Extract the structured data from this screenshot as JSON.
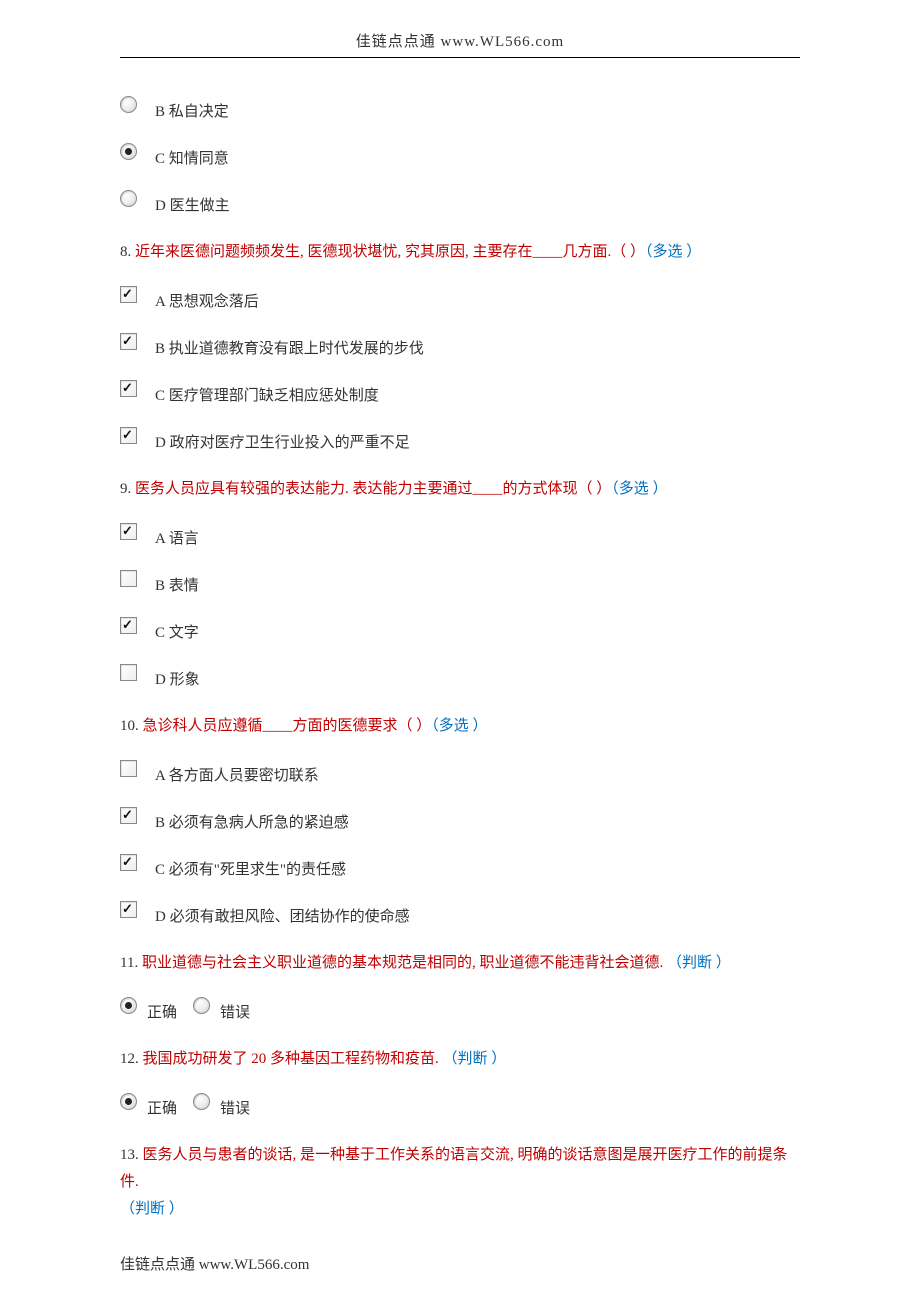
{
  "header": "佳链点点通 www.WL566.com",
  "footer": "佳链点点通 www.WL566.com",
  "q7_options": [
    {
      "key": "B",
      "text": "B 私自决定",
      "checked": false
    },
    {
      "key": "C",
      "text": "C 知情同意",
      "checked": true
    },
    {
      "key": "D",
      "text": "D 医生做主",
      "checked": false
    }
  ],
  "q8": {
    "num": "8.  ",
    "text": "近年来医德问题频频发生, 医德现状堪忧, 究其原因, 主要存在____几方面.（ ）",
    "tag": "（多选 ）",
    "options": [
      {
        "text": "A 思想观念落后",
        "checked": true
      },
      {
        "text": "B 执业道德教育没有跟上时代发展的步伐",
        "checked": true
      },
      {
        "text": "C 医疗管理部门缺乏相应惩处制度",
        "checked": true
      },
      {
        "text": "D 政府对医疗卫生行业投入的严重不足",
        "checked": true
      }
    ]
  },
  "q9": {
    "num": "9.  ",
    "text": "医务人员应具有较强的表达能力. 表达能力主要通过____的方式体现（ ）",
    "tag": "（多选 ）",
    "options": [
      {
        "text": "A 语言",
        "checked": true
      },
      {
        "text": "B 表情",
        "checked": false
      },
      {
        "text": "C 文字",
        "checked": true
      },
      {
        "text": "D 形象",
        "checked": false
      }
    ]
  },
  "q10": {
    "num": "10.  ",
    "text": "急诊科人员应遵循____方面的医德要求（ ）",
    "tag": "（多选 ）",
    "options": [
      {
        "text": "A 各方面人员要密切联系",
        "checked": false
      },
      {
        "text": "B 必须有急病人所急的紧迫感",
        "checked": true
      },
      {
        "text": "C 必须有\"死里求生\"的责任感",
        "checked": true
      },
      {
        "text": "D 必须有敢担风险、团结协作的使命感",
        "checked": true
      }
    ]
  },
  "q11": {
    "num": "11.  ",
    "text": "职业道德与社会主义职业道德的基本规范是相同的, 职业道德不能违背社会道德.  ",
    "tag": "（判断 ）",
    "true_label": "正确",
    "false_label": "错误",
    "selected": "true"
  },
  "q12": {
    "num": "12.  ",
    "text": "我国成功研发了 20 多种基因工程药物和疫苗.  ",
    "tag": "（判断 ）",
    "true_label": "正确",
    "false_label": "错误",
    "selected": "true"
  },
  "q13": {
    "num": "13.  ",
    "text": "医务人员与患者的谈话, 是一种基于工作关系的语言交流,  明确的谈话意图是展开医疗工作的前提条件.",
    "tag": "（判断 ）"
  }
}
